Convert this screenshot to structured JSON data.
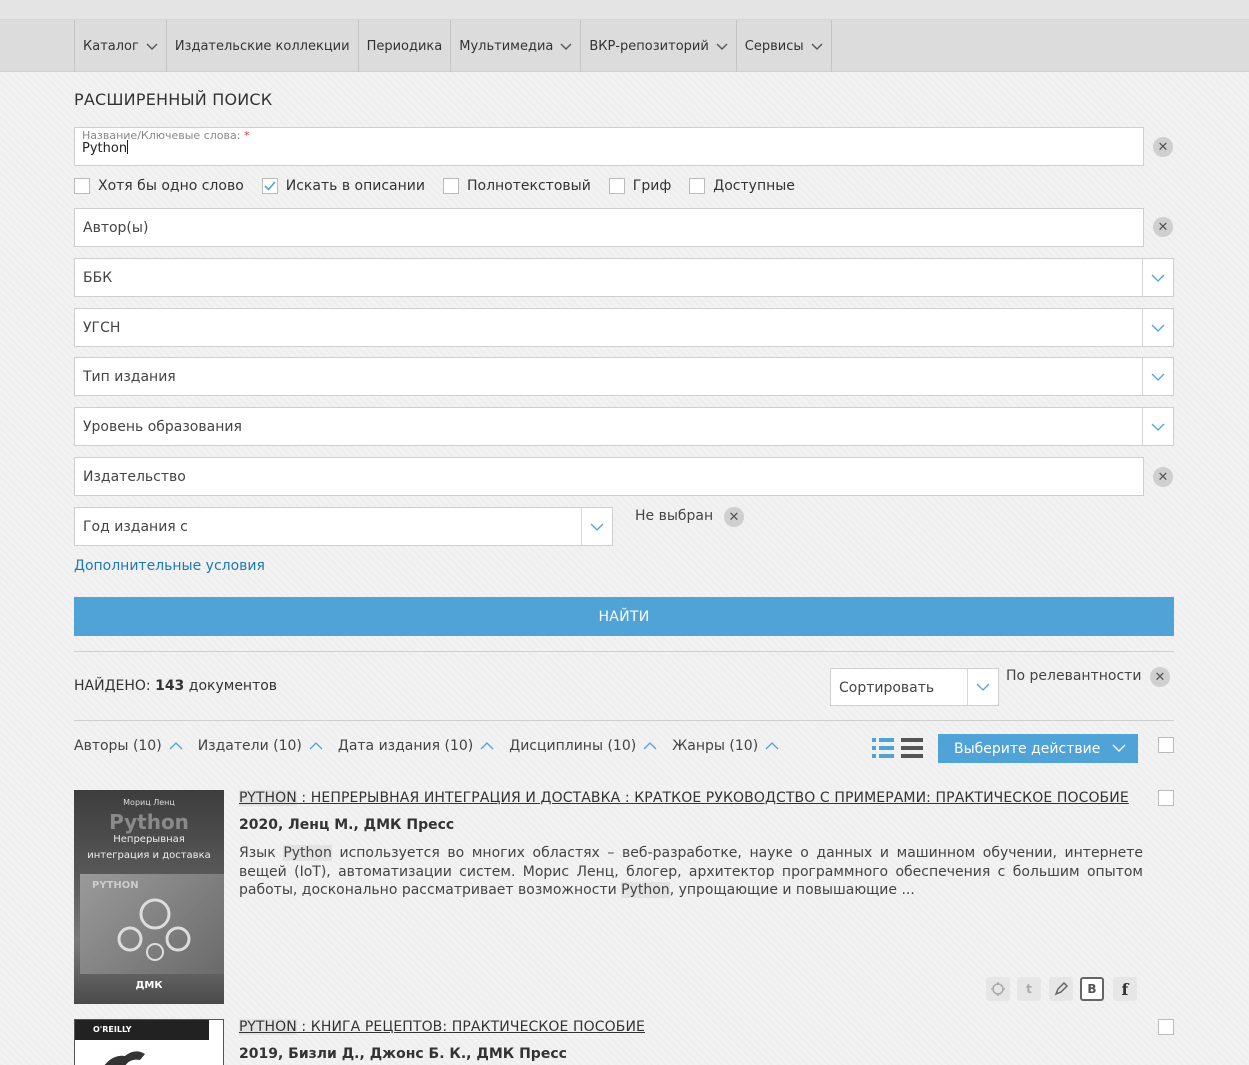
{
  "nav": {
    "items": [
      {
        "label": "Каталог",
        "dropdown": true
      },
      {
        "label": "Издательские коллекции",
        "dropdown": false
      },
      {
        "label": "Периодика",
        "dropdown": false
      },
      {
        "label": "Мультимедиа",
        "dropdown": true
      },
      {
        "label": "ВКР-репозиторий",
        "dropdown": true
      },
      {
        "label": "Сервисы",
        "dropdown": true
      }
    ]
  },
  "search": {
    "title": "РАСШИРЕННЫЙ ПОИСК",
    "keywords_label": "Название/Ключевые слова:",
    "keywords_required_mark": "*",
    "keywords_value": "Python",
    "checkboxes": [
      {
        "label": "Хотя бы одно слово",
        "checked": false
      },
      {
        "label": "Искать в описании",
        "checked": true
      },
      {
        "label": "Полнотекстовый",
        "checked": false
      },
      {
        "label": "Гриф",
        "checked": false
      },
      {
        "label": "Доступные",
        "checked": false
      }
    ],
    "authors_placeholder": "Автор(ы)",
    "bbk_placeholder": "ББК",
    "ugsn_placeholder": "УГСН",
    "edition_type_placeholder": "Тип издания",
    "education_level_placeholder": "Уровень образования",
    "publisher_placeholder": "Издательство",
    "year_from_placeholder": "Год издания с",
    "year_value": "Не выбран",
    "more_conditions_label": "Дополнительные условия",
    "find_button_label": "НАЙТИ"
  },
  "results": {
    "found_label": "НАЙДЕНО:",
    "found_count": "143",
    "found_suffix": "документов",
    "sort_placeholder": "Сортировать",
    "sort_value": "По релевантности",
    "facets": [
      {
        "label": "Авторы (10)"
      },
      {
        "label": "Издатели (10)"
      },
      {
        "label": "Дата издания (10)"
      },
      {
        "label": "Дисциплины (10)"
      },
      {
        "label": "Жанры (10)"
      }
    ],
    "action_button_label": "Выберите действие",
    "items": [
      {
        "title_highlight": "PYTHON",
        "title_rest": " : НЕПРЕРЫВНАЯ ИНТЕГРАЦИЯ И ДОСТАВКА : КРАТКОЕ РУКОВОДСТВО С ПРИМЕРАМИ: ПРАКТИЧЕСКОЕ ПОСОБИЕ",
        "meta": "2020, Ленц М., ДМК Пресс",
        "desc_1": "Язык ",
        "desc_hl_1": "Python",
        "desc_2": " используется во многих областях – веб-разработке, науке о данных и машинном обучении, интернете вещей (IoT), автоматизации систем. Морис Ленц, блогер, архитектор программного обеспечения с большим опытом работы, досконально рассматривает возможности ",
        "desc_hl_2": "Python",
        "desc_3": ", упрощающие и повышающие ...",
        "cover": {
          "author": "Мориц Ленц",
          "title": "Python",
          "subtitle_1": "Непрерывная",
          "subtitle_2": "интеграция и доставка",
          "badge": "PYTHON",
          "publisher": "ДМК"
        }
      },
      {
        "title_highlight": "PYTHON",
        "title_rest": " : КНИГА РЕЦЕПТОВ: ПРАКТИЧЕСКОЕ ПОСОБИЕ",
        "meta": "2019, Бизли Д., Джонс Б. К., ДМК Пресс",
        "cover": {
          "publisher": "O'REILLY"
        }
      }
    ],
    "share_icons": [
      "bookmark-icon",
      "twitter-icon",
      "livejournal-icon",
      "vk-icon",
      "facebook-icon"
    ]
  },
  "colors": {
    "accent": "#4fa3d6",
    "link": "#1f78b4",
    "nav_bg": "#dcdcdc"
  }
}
